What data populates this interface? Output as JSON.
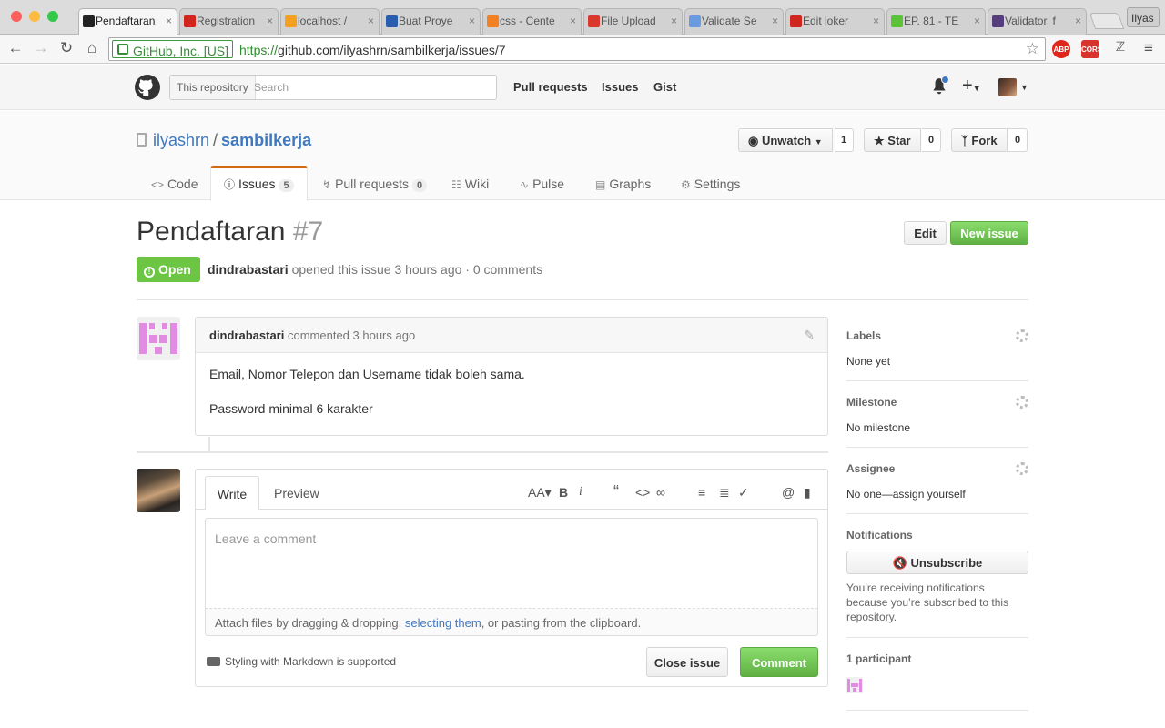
{
  "browser": {
    "profile_name": "Ilyas",
    "tabs": [
      {
        "title": "Pendaftaran",
        "active": true,
        "favicon_color": "#222222"
      },
      {
        "title": "Registration",
        "active": false,
        "favicon_color": "#d0261e"
      },
      {
        "title": "localhost /",
        "active": false,
        "favicon_color": "#f4a020"
      },
      {
        "title": "Buat Proye",
        "active": false,
        "favicon_color": "#2a5db0"
      },
      {
        "title": "css - Cente",
        "active": false,
        "favicon_color": "#f48024"
      },
      {
        "title": "File Upload",
        "active": false,
        "favicon_color": "#d9382c"
      },
      {
        "title": "Validate Se",
        "active": false,
        "favicon_color": "#6a9be0"
      },
      {
        "title": "Edit loker",
        "active": false,
        "favicon_color": "#d0261e"
      },
      {
        "title": "EP. 81 - TE",
        "active": false,
        "favicon_color": "#5cc23a"
      },
      {
        "title": "Validator, f",
        "active": false,
        "favicon_color": "#563d7c"
      }
    ],
    "ev_badge": "GitHub, Inc. [US]",
    "url_scheme": "https://",
    "url_rest": "github.com/ilyashrn/sambilkerja/issues/7",
    "extensions": [
      "ABP",
      "CORS"
    ]
  },
  "header": {
    "search_scope": "This repository",
    "search_placeholder": "Search",
    "nav": [
      "Pull requests",
      "Issues",
      "Gist"
    ]
  },
  "repo": {
    "owner": "ilyashrn",
    "separator": "/",
    "name": "sambilkerja",
    "watch_label": "Unwatch",
    "watch_count": "1",
    "star_label": "Star",
    "star_count": "0",
    "fork_label": "Fork",
    "fork_count": "0",
    "tabs": [
      {
        "label": "Code",
        "count": ""
      },
      {
        "label": "Issues",
        "count": "5"
      },
      {
        "label": "Pull requests",
        "count": "0"
      },
      {
        "label": "Wiki",
        "count": ""
      },
      {
        "label": "Pulse",
        "count": ""
      },
      {
        "label": "Graphs",
        "count": ""
      },
      {
        "label": "Settings",
        "count": ""
      }
    ]
  },
  "issue": {
    "title": "Pendaftaran",
    "number": "#7",
    "edit_label": "Edit",
    "new_issue_label": "New issue",
    "state": "Open",
    "author": "dindrabastari",
    "meta_text": "opened this issue 3 hours ago · 0 comments"
  },
  "comment": {
    "author": "dindrabastari",
    "action": "commented 3 hours ago",
    "body": [
      "Email, Nomor Telepon dan Username tidak boleh sama.",
      "Password minimal 6 karakter"
    ]
  },
  "new_comment": {
    "tab_write": "Write",
    "tab_preview": "Preview",
    "placeholder": "Leave a comment",
    "attach_before": "Attach files by dragging & dropping, ",
    "attach_link": "selecting them",
    "attach_after": ", or pasting from the clipboard.",
    "markdown_note": "Styling with Markdown is supported",
    "close_label": "Close issue",
    "comment_label": "Comment"
  },
  "sidebar": {
    "labels_title": "Labels",
    "labels_value": "None yet",
    "milestone_title": "Milestone",
    "milestone_value": "No milestone",
    "assignee_title": "Assignee",
    "assignee_value": "No one—assign yourself",
    "notifications_title": "Notifications",
    "unsubscribe_label": "Unsubscribe",
    "notifications_reason": "You’re receiving notifications because you’re subscribed to this repository.",
    "participants_title": "1 participant"
  }
}
